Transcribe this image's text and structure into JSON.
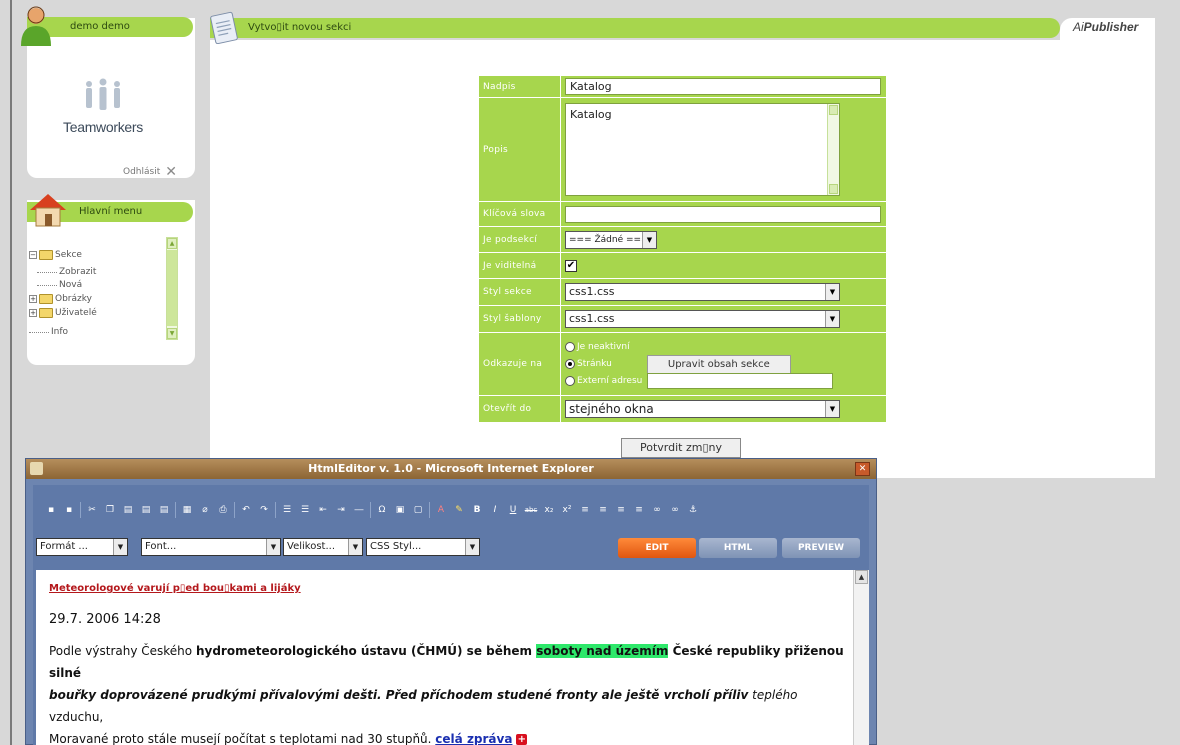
{
  "user_panel": {
    "username": "demo demo",
    "logo_text": "Teamworkers",
    "logout_label": "Odhlásit"
  },
  "menu_panel": {
    "title": "Hlavní menu",
    "tree": [
      {
        "label": "Sekce",
        "level": 0,
        "expander": "−",
        "folder": true
      },
      {
        "label": "Zobrazit",
        "level": 1
      },
      {
        "label": "Nová",
        "level": 1
      },
      {
        "label": "Obrázky",
        "level": 0,
        "expander": "+",
        "folder": true
      },
      {
        "label": "Uživatelé",
        "level": 0,
        "expander": "+",
        "folder": true
      },
      {
        "label": "Info",
        "level": 0
      }
    ]
  },
  "main": {
    "tab_title": "Vytvo▯it novou sekci",
    "brand_prefix": "Ai",
    "brand_suffix": "Publisher",
    "form": {
      "heading_label": "Nadpis",
      "heading_value": "Katalog",
      "desc_label": "Popis",
      "desc_value": "Katalog",
      "keywords_label": "Klíčová slova",
      "keywords_value": "",
      "subsection_label": "Je podsekcí",
      "subsection_value": "=== Žádné ===",
      "visible_label": "Je viditelná",
      "visible_checked": true,
      "section_style_label": "Styl sekce",
      "section_style_value": "css1.css",
      "template_style_label": "Styl šablony",
      "template_style_value": "css1.css",
      "link_label": "Odkazuje na",
      "link_options": [
        "Je neaktivní",
        "Stránku",
        "Externí adresu"
      ],
      "link_selected": "Stránku",
      "edit_content_button": "Upravit obsah sekce",
      "external_url_value": "",
      "open_in_label": "Otevřít do",
      "open_in_value": "stejného okna"
    },
    "confirm_button": "Potvrdit zm▯ny"
  },
  "editor": {
    "window_title": "HtmlEditor v. 1.0 - Microsoft Internet Explorer",
    "format_select": "Formát ...",
    "font_select": "Font...",
    "size_select": "Velikost...",
    "css_select": "CSS Styl...",
    "mode_edit": "EDIT",
    "mode_html": "HTML",
    "mode_preview": "PREVIEW",
    "toolbar_icons": [
      "save-icon",
      "save-as-icon",
      "cut-icon",
      "copy-icon",
      "paste-icon",
      "paste-text-icon",
      "paste-word-icon",
      "table-icon",
      "eraser-icon",
      "print-icon",
      "undo-icon",
      "redo-icon",
      "unordered-list-icon",
      "ordered-list-icon",
      "outdent-icon",
      "indent-icon",
      "hr-icon",
      "special-char-icon",
      "image-icon",
      "flash-icon",
      "text-color-icon",
      "highlight-icon",
      "bold-icon",
      "italic-icon",
      "underline-icon",
      "strikethrough-icon",
      "subscript-icon",
      "superscript-icon",
      "align-left-icon",
      "align-center-icon",
      "align-right-icon",
      "justify-icon",
      "link-icon",
      "unlink-icon",
      "anchor-icon"
    ],
    "content": {
      "headline": "Meteorologové varují p▯ed bou▯kami a lijáky",
      "date": "29.7. 2006 14:28",
      "p_1": "Podle výstrahy Českého ",
      "p_2": "hydrometeorologického ústavu (ČHMÚ) se během ",
      "p_3": "soboty nad územím",
      "p_4": " České republiky přiženou silné",
      "p_5": "bouřky doprovázené prudkými přívalovými dešti. Před příchodem studené fronty ale ještě vrcholí příliv",
      "p_6": " teplého",
      "p_7": " vzduchu,",
      "p_8": "Moravané proto stále musejí počítat s teplotami nad 30 stupňů. ",
      "more_link": "celá zpráva"
    }
  },
  "colors": {
    "accent_green": "#a7d64d",
    "edit_orange": "#e0560f",
    "highlight_green": "#2ee86b",
    "link_red": "#b4181c"
  }
}
